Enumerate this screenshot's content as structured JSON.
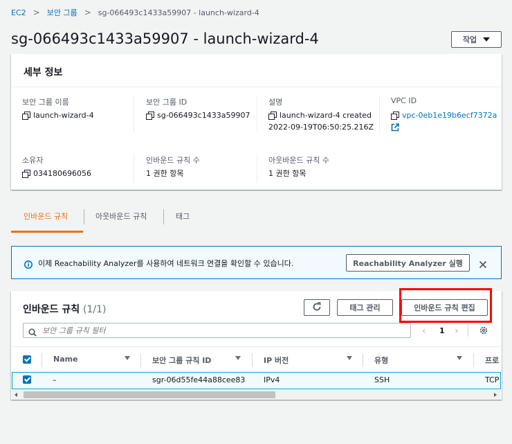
{
  "breadcrumb": {
    "items": [
      "EC2",
      "보안 그룹"
    ],
    "current": "sg-066493c1433a59907 - launch-wizard-4"
  },
  "page": {
    "title": "sg-066493c1433a59907 - launch-wizard-4",
    "actions_label": "작업"
  },
  "details": {
    "title": "세부 정보",
    "fields": {
      "sg_name_label": "보안 그룹 이름",
      "sg_name": "launch-wizard-4",
      "sg_id_label": "보안 그룹 ID",
      "sg_id": "sg-066493c1433a59907",
      "desc_label": "설명",
      "desc_line1": "launch-wizard-4 created",
      "desc_line2": "2022-09-19T06:50:25.216Z",
      "vpc_label": "VPC ID",
      "vpc_id": "vpc-0eb1e19b6ecf7372a",
      "owner_label": "소유자",
      "owner": "034180696056",
      "inbound_count_label": "인바운드 규칙 수",
      "inbound_count": "1 권한 항목",
      "outbound_count_label": "아웃바운드 규칙 수",
      "outbound_count": "1 권한 항목"
    }
  },
  "tabs": [
    "인바운드 규칙",
    "아웃바운드 규칙",
    "태그"
  ],
  "info": {
    "message": "이제 Reachability Analyzer를 사용하여 네트워크 연결을 확인할 수 있습니다.",
    "run_label": "Reachability Analyzer 실행"
  },
  "rules": {
    "title": "인바운드 규칙",
    "count": "(1/1)",
    "manage_tags_label": "태그 관리",
    "edit_label": "인바운드 규칙 편집",
    "filter_placeholder": "보안 그룹 규칙 필터",
    "page_number": "1",
    "columns": [
      "Name",
      "보안 그룹 규칙 ID",
      "IP 버전",
      "유형",
      "프로"
    ],
    "rows": [
      {
        "name": "–",
        "rule_id": "sgr-06d55fe44a88cee83",
        "ip_version": "IPv4",
        "type": "SSH",
        "protocol": "TCP"
      }
    ]
  },
  "colors": {
    "accent": "#ec7211",
    "link": "#0073bb",
    "highlight": "#ff0000"
  }
}
